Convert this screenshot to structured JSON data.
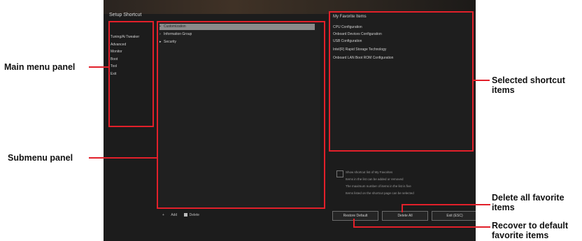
{
  "screen": {
    "title": "Setup Shortcut",
    "main_menu_items": [
      "Tuning/Ai Tweaker",
      "Advanced",
      "Monitor",
      "Boot",
      "Tool",
      "Exit"
    ],
    "submenu_items": [
      {
        "label": "Customization",
        "selected": true
      },
      {
        "label": "Information Group",
        "selected": false
      },
      {
        "label": "Security",
        "selected": false
      }
    ],
    "shortcut_panel_title": "My Favorite Items",
    "shortcut_items": [
      "CPU Configuration",
      "Onboard Devices Configuration",
      "USB Configuration",
      "Intel(R) Rapid Storage Technology",
      "Onboard LAN Boot ROM Configuration"
    ],
    "fine_print": [
      "Show shortcut list of My Favorites",
      "Items in the list can be added or removed",
      "The maximum number of items in the list is five",
      "Items listed on the shortcut page can be selected"
    ],
    "buttons": [
      "Restore Default",
      "Delete All",
      "Exit (ESC)"
    ],
    "bottom_icons": [
      "+",
      "Add",
      "Delete"
    ]
  },
  "callouts": {
    "main_menu_panel": "Main menu panel",
    "submenu_panel": "Submenu panel",
    "selected_shortcut_items": [
      "Selected shortcut",
      "items"
    ],
    "delete_all_favorite_items": [
      "Delete all favorite",
      "items"
    ],
    "recover_default_favorite_items": [
      "Recover to default",
      "favorite items"
    ]
  },
  "colors": {
    "annotation_red": "#e2202a",
    "screen_bg": "#1c1c1c"
  }
}
